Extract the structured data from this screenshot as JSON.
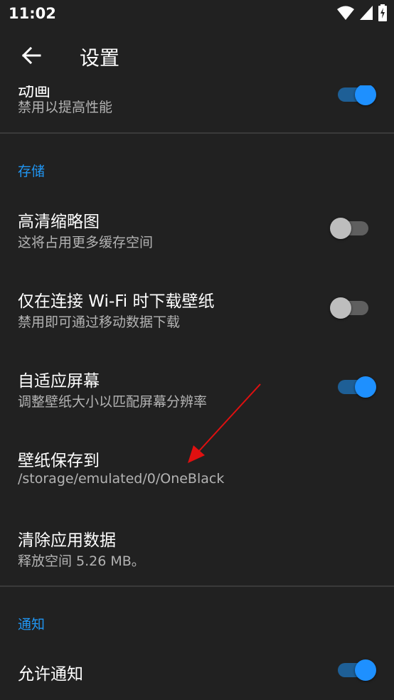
{
  "status_bar": {
    "time": "11:02",
    "icons": [
      "wifi-icon",
      "signal-icon",
      "battery-charging-icon"
    ]
  },
  "app_bar": {
    "back_icon": "arrow-left-icon",
    "title": "设置"
  },
  "partial_item": {
    "title": "动画",
    "summary": "禁用以提高性能",
    "switch_on": true
  },
  "storage": {
    "header": "存储",
    "items": [
      {
        "title": "高清缩略图",
        "summary": "这将占用更多缓存空间",
        "switch_on": false
      },
      {
        "title": "仅在连接 Wi-Fi 时下载壁纸",
        "summary": "禁用即可通过移动数据下载",
        "switch_on": false
      },
      {
        "title": "自适应屏幕",
        "summary": "调整壁纸大小以匹配屏幕分辨率",
        "switch_on": true
      },
      {
        "title": "壁纸保存到",
        "summary": "/storage/emulated/0/OneBlack"
      },
      {
        "title": "清除应用数据",
        "summary": "释放空间 5.26 MB。"
      }
    ]
  },
  "notification": {
    "header": "通知",
    "items": [
      {
        "title": "允许通知",
        "switch_on": true
      }
    ]
  },
  "colors": {
    "accent": "#2196f3",
    "switch_on_thumb": "#1e90ff",
    "switch_on_track": "#1e5f96",
    "switch_off_thumb": "#bdbdbd",
    "switch_off_track": "#5f5f5f",
    "annotation_arrow": "#e01010",
    "background": "#212121"
  }
}
